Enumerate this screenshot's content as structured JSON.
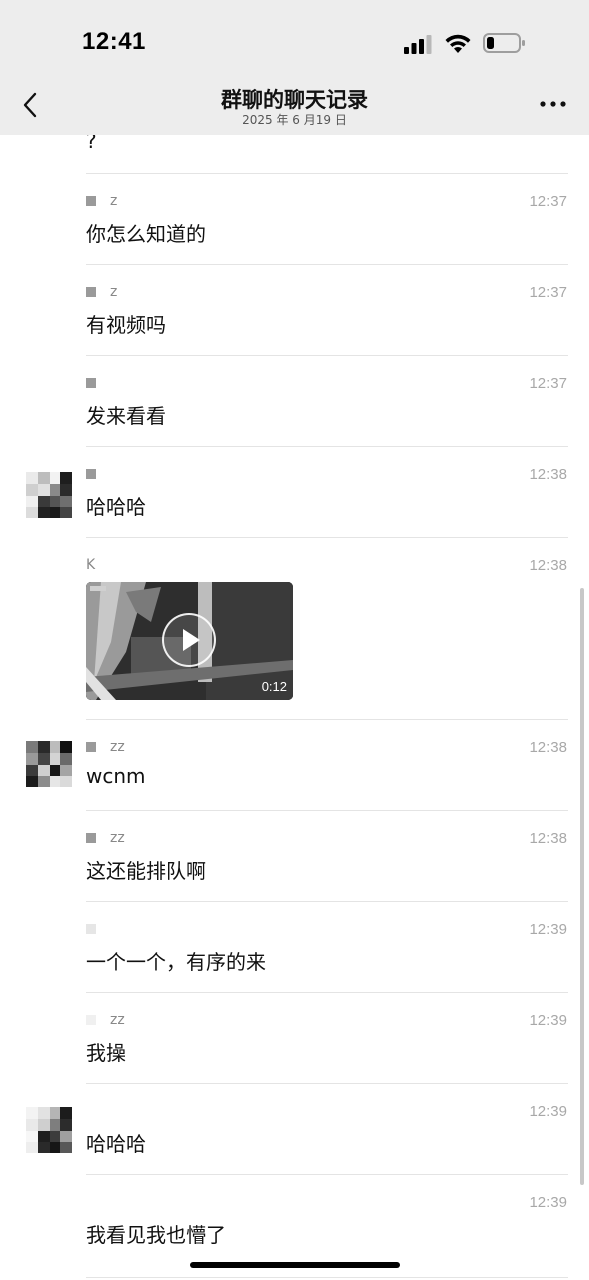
{
  "status_bar": {
    "time": "12:41",
    "icons": [
      "cellular-signal-icon",
      "wifi-icon",
      "battery-icon"
    ]
  },
  "nav": {
    "title": "群聊的聊天记录",
    "subtitle": "2025 年 6 月19 日",
    "back_icon": "chevron-left-icon",
    "more_icon": "more-dots-icon"
  },
  "partial_text": "?",
  "messages": [
    {
      "sender": "z",
      "time": "12:37",
      "text": "你怎么知道的"
    },
    {
      "sender": "z",
      "time": "12:37",
      "text": "有视频吗"
    },
    {
      "sender": "",
      "time": "12:37",
      "text": "发来看看"
    },
    {
      "sender": "",
      "time": "12:38",
      "text": "哈哈哈"
    },
    {
      "sender": "K",
      "time": "12:38",
      "video_duration": "0:12"
    },
    {
      "sender": "zz",
      "time": "12:38",
      "text": "wcnm"
    },
    {
      "sender": "zz",
      "time": "12:38",
      "text": "这还能排队啊"
    },
    {
      "sender": "",
      "time": "12:39",
      "text": "一个一个，有序的来"
    },
    {
      "sender": "zz",
      "time": "12:39",
      "text": "我操"
    },
    {
      "sender": "",
      "time": "12:39",
      "text": "哈哈哈"
    },
    {
      "sender": "",
      "time": "12:39",
      "text": "我看见我也懵了"
    }
  ],
  "colors": {
    "header_bg": "#ededed",
    "divider": "#e4e4e4",
    "time_text": "#a8a8a8",
    "sender_text": "#888888"
  }
}
